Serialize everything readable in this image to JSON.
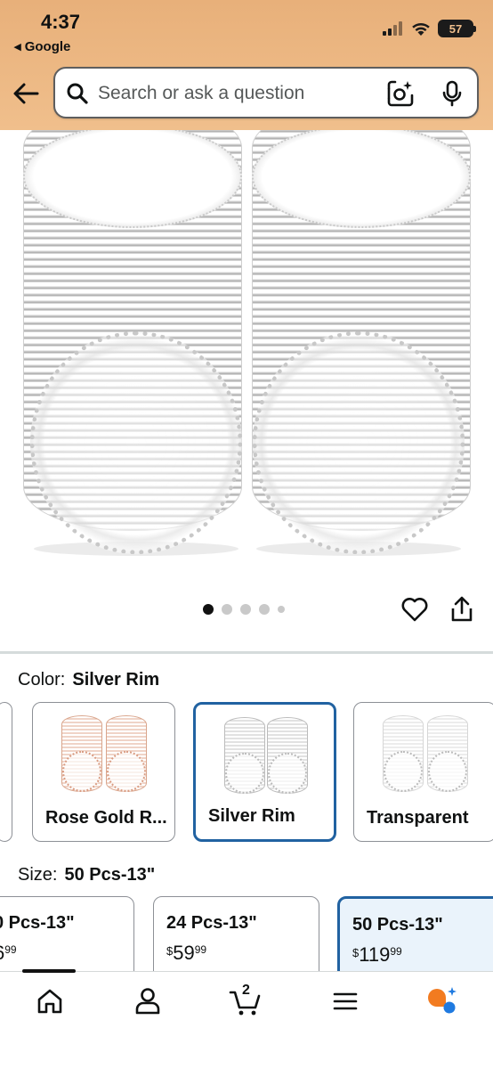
{
  "status_bar": {
    "time": "4:37",
    "back_app": "◂ Google",
    "battery": "57"
  },
  "header": {
    "search_placeholder": "Search or ask a question",
    "icons": [
      "back-arrow-icon",
      "search-icon",
      "camera-lens-icon",
      "microphone-icon"
    ]
  },
  "gallery": {
    "image_count": 5,
    "active_index": 0
  },
  "color": {
    "label": "Color:",
    "selected": "Silver Rim",
    "options": [
      "Rose Gold R...",
      "Silver Rim",
      "Transparent"
    ]
  },
  "size": {
    "label": "Size:",
    "selected": "50 Pcs-13\"",
    "options": [
      {
        "name": "0 Pcs-13\"",
        "currency": "",
        "whole": "6",
        "cents": "99"
      },
      {
        "name": "24 Pcs-13\"",
        "currency": "$",
        "whole": "59",
        "cents": "99"
      },
      {
        "name": "50 Pcs-13\"",
        "currency": "$",
        "whole": "119",
        "cents": "99"
      }
    ]
  },
  "bottom_nav": {
    "cart_count": "2",
    "items": [
      "home-icon",
      "account-icon",
      "cart-icon",
      "menu-icon",
      "rufus-icon"
    ]
  },
  "colors": {
    "header_bg": "#f0bf8c",
    "selected_border": "#2162a1",
    "rufus_orange": "#f27b20",
    "rufus_blue": "#1f7ae0"
  }
}
